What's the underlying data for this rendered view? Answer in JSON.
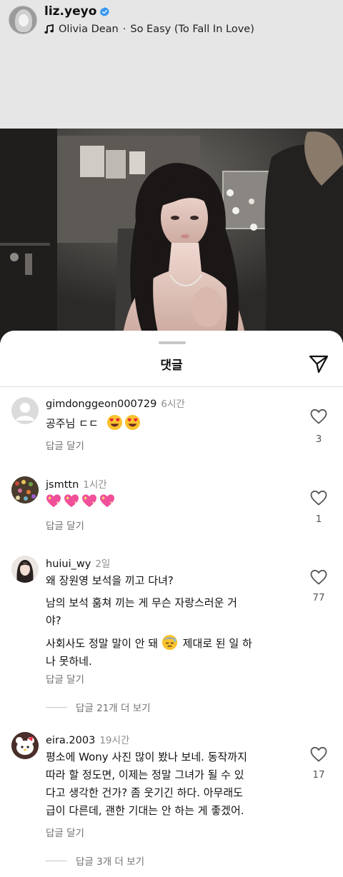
{
  "header": {
    "username": "liz.yeyo",
    "music_separator": "·",
    "music_artist": "Olivia Dean",
    "music_title": "So Easy (To Fall In Love)"
  },
  "sheet": {
    "title": "댓글"
  },
  "comments": [
    {
      "username": "gimdonggeon000729",
      "time": "6시간",
      "text": "공주님 ㄷㄷ",
      "emoji": [
        "heart-eyes-emoji",
        "heart-eyes-emoji"
      ],
      "reply_label": "답글 달기",
      "likes": "3"
    },
    {
      "username": "jsmttn",
      "time": "1시간",
      "text": "",
      "emoji": [
        "sparkling-heart-emoji",
        "sparkling-heart-emoji",
        "sparkling-heart-emoji",
        "sparkling-heart-emoji"
      ],
      "reply_label": "답글 달기",
      "likes": "1"
    },
    {
      "username": "huiui_wy",
      "time": "2일",
      "line1": "왜 장원영 보석을 끼고 다녀?",
      "line2": "남의 보석 훔쳐 끼는 게 무슨 자랑스러운 거",
      "line3": "야?",
      "line4a": "사회사도 정말 말이 안 돼",
      "line4b": "제대로 된 일 하",
      "line5": "나 못하네.",
      "emoji": [
        "sweat-face-emoji"
      ],
      "reply_label": "답글 달기",
      "likes": "77",
      "more_replies": "답글 21개 더 보기"
    },
    {
      "username": "eira.2003",
      "time": "19시간",
      "line1": "평소에 Wony 사진 많이 봤나 보네. 동작까지",
      "line2": "따라 할 정도면, 이제는 정말 그녀가 될 수 있",
      "line3": "다고 생각한 건가? 좀 웃기긴 하다. 아무래도",
      "line4": "급이 다른데, 괜한 기대는 안 하는 게 좋겠어.",
      "reply_label": "답글 달기",
      "likes": "17",
      "more_replies": "답글 3개 더 보기"
    }
  ],
  "colors": {
    "verified": "#3897f0",
    "secondary_text": "#737373",
    "divider": "#dbdbdb"
  },
  "icons": [
    "verified-badge-icon",
    "music-note-icon",
    "share-send-icon",
    "heart-outline-icon"
  ]
}
